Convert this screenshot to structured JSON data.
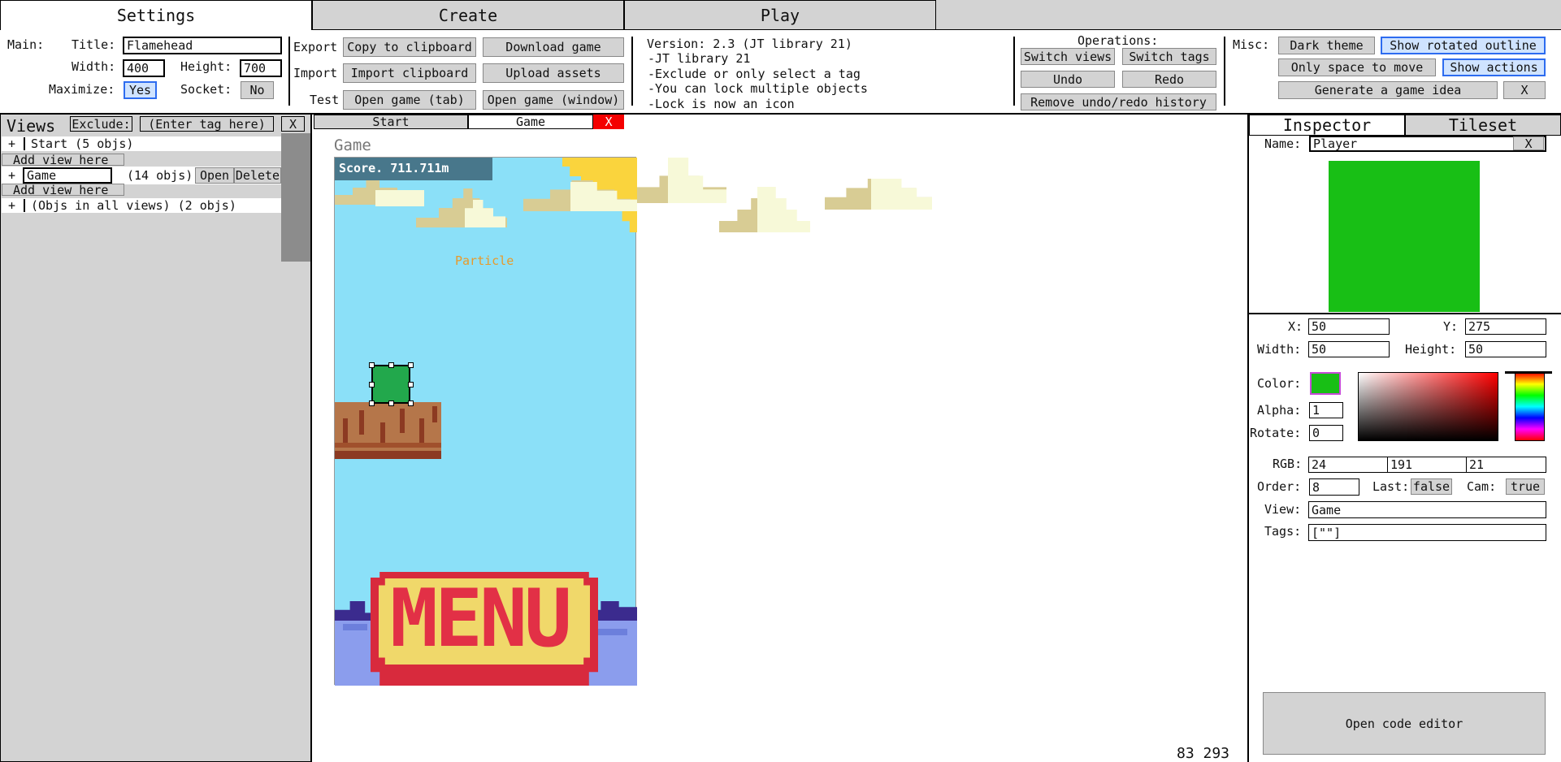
{
  "tabs": {
    "settings": "Settings",
    "create": "Create",
    "play": "Play"
  },
  "main": {
    "label": "Main:",
    "title_label": "Title:",
    "title_value": "Flamehead",
    "width_label": "Width:",
    "width_value": "400",
    "height_label": "Height:",
    "height_value": "700",
    "maximize_label": "Maximize:",
    "maximize_value": "Yes",
    "socket_label": "Socket:",
    "socket_value": "No"
  },
  "export_import": {
    "export_label": "Export",
    "import_label": "Import",
    "test_label": "Test",
    "copy_clipboard": "Copy to clipboard",
    "download_game": "Download game",
    "import_clipboard": "Import clipboard",
    "upload_assets": "Upload assets",
    "open_tab": "Open game (tab)",
    "open_window": "Open game (window)"
  },
  "version_notes": [
    "Version: 2.3 (JT library 21)",
    "-JT library 21",
    "-Exclude or only select a tag",
    "-You can lock multiple objects",
    "-Lock is now an icon"
  ],
  "operations": {
    "title": "Operations:",
    "switch_views": "Switch views",
    "switch_tags": "Switch tags",
    "undo": "Undo",
    "redo": "Redo",
    "remove_history": "Remove undo/redo history"
  },
  "misc": {
    "label": "Misc:",
    "dark_theme": "Dark theme",
    "show_rotated": "Show rotated outline",
    "only_space": "Only space to move",
    "show_actions": "Show actions",
    "generate_idea": "Generate a game idea",
    "close": "X"
  },
  "views": {
    "title": "Views",
    "exclude_button": "Exclude:",
    "tag_placeholder": "(Enter tag here)",
    "clear": "X",
    "add_view": "Add view here",
    "start": {
      "expander": "+",
      "label": "Start (5 objs)"
    },
    "game": {
      "expander": "+",
      "name": "Game",
      "count": "(14 objs)",
      "open": "Open",
      "delete": "Delete"
    },
    "all": {
      "expander": "+",
      "label": "(Objs in all views) (2 objs)"
    }
  },
  "editor_tabs": {
    "start": "Start",
    "game": "Game",
    "close": "X"
  },
  "canvas": {
    "view_title": "Game",
    "score": "Score. 711.711m",
    "particle": "Particle",
    "menu_text": "MENU",
    "cursor_readout": "83 293"
  },
  "inspector": {
    "tab_inspector": "Inspector",
    "tab_tileset": "Tileset",
    "name_label": "Name:",
    "name_value": "Player",
    "name_clear": "X",
    "x_label": "X:",
    "x_value": "50",
    "y_label": "Y:",
    "y_value": "275",
    "width_label": "Width:",
    "width_value": "50",
    "height_label": "Height:",
    "height_value": "50",
    "color_label": "Color:",
    "alpha_label": "Alpha:",
    "alpha_value": "1",
    "rotate_label": "Rotate:",
    "rotate_value": "0",
    "rgb_label": "RGB:",
    "r": "24",
    "g": "191",
    "b": "21",
    "order_label": "Order:",
    "order_value": "8",
    "last_label": "Last:",
    "last_value": "false",
    "cam_label": "Cam:",
    "cam_value": "true",
    "view_label": "View:",
    "view_value": "Game",
    "tags_label": "Tags:",
    "tags_value": "[\"\"]",
    "code_editor": "Open code editor"
  },
  "colors": {
    "player": "#18bf15",
    "accent": "#2d6cf0",
    "sky": "#8be0f8",
    "panel": "#d3d3d3"
  }
}
